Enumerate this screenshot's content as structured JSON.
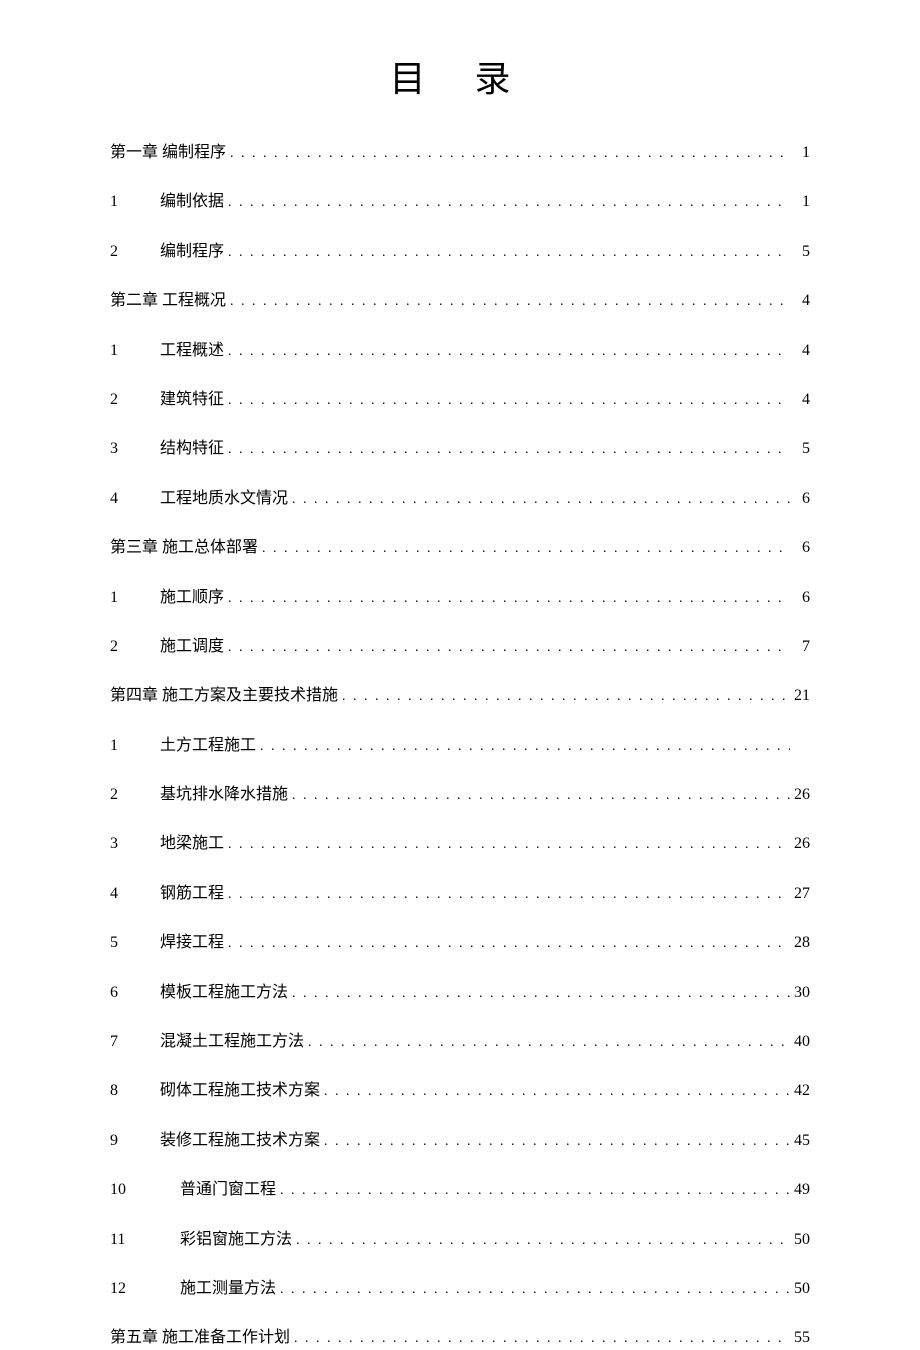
{
  "title": "目  录",
  "entries": [
    {
      "type": "chapter",
      "num": "",
      "label": "第一章 编制程序",
      "page": "1"
    },
    {
      "type": "sub",
      "num": "1",
      "label": "编制依据",
      "page": "1"
    },
    {
      "type": "sub",
      "num": "2",
      "label": "编制程序",
      "page": "5"
    },
    {
      "type": "chapter",
      "num": "",
      "label": "第二章 工程概况",
      "page": "4"
    },
    {
      "type": "sub",
      "num": "1",
      "label": "工程概述",
      "page": "4"
    },
    {
      "type": "sub",
      "num": "2",
      "label": "建筑特征",
      "page": "4"
    },
    {
      "type": "sub",
      "num": "3",
      "label": "结构特征",
      "page": "5"
    },
    {
      "type": "sub",
      "num": "4",
      "label": "工程地质水文情况",
      "page": "6"
    },
    {
      "type": "chapter",
      "num": "",
      "label": "第三章 施工总体部署",
      "page": "6"
    },
    {
      "type": "sub",
      "num": "1",
      "label": "施工顺序",
      "page": "6"
    },
    {
      "type": "sub",
      "num": "2",
      "label": "施工调度",
      "page": "7"
    },
    {
      "type": "chapter",
      "num": "",
      "label": "第四章 施工方案及主要技术措施",
      "page": "21"
    },
    {
      "type": "sub",
      "num": "1",
      "label": "土方工程施工",
      "page": ""
    },
    {
      "type": "sub",
      "num": "2",
      "label": "基坑排水降水措施",
      "page": "26"
    },
    {
      "type": "sub",
      "num": "3",
      "label": "地梁施工",
      "page": "26"
    },
    {
      "type": "sub",
      "num": "4",
      "label": "钢筋工程",
      "page": "27"
    },
    {
      "type": "sub",
      "num": "5",
      "label": "焊接工程",
      "page": "28"
    },
    {
      "type": "sub",
      "num": "6",
      "label": "模板工程施工方法",
      "page": "30"
    },
    {
      "type": "sub",
      "num": "7",
      "label": "混凝土工程施工方法",
      "page": "40"
    },
    {
      "type": "sub",
      "num": "8",
      "label": "砌体工程施工技术方案",
      "page": "42"
    },
    {
      "type": "sub",
      "num": "9",
      "label": "装修工程施工技术方案",
      "page": "45"
    },
    {
      "type": "sub",
      "num": "10",
      "label": "普通门窗工程",
      "page": "49",
      "indent": true
    },
    {
      "type": "sub",
      "num": "11",
      "label": "彩铝窗施工方法",
      "page": "50",
      "indent": true
    },
    {
      "type": "sub",
      "num": "12",
      "label": "施工测量方法",
      "page": "50",
      "indent": true
    },
    {
      "type": "chapter",
      "num": "",
      "label": "第五章  施工准备工作计划",
      "page": "55"
    }
  ]
}
